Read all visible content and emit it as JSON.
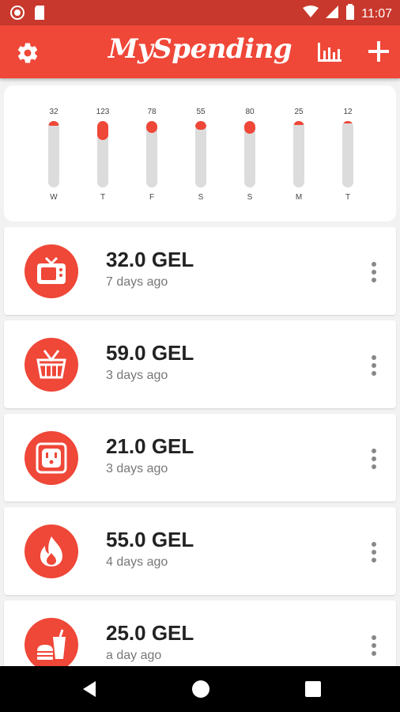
{
  "status_bar": {
    "time": "11:07"
  },
  "app_bar": {
    "title": "MySpending"
  },
  "chart_data": {
    "type": "bar",
    "categories": [
      "W",
      "T",
      "F",
      "S",
      "S",
      "M",
      "T"
    ],
    "values": [
      32,
      123,
      78,
      55,
      80,
      25,
      12
    ],
    "value_labels": [
      "32",
      "123",
      "78",
      "55",
      "80",
      "25",
      "12"
    ],
    "max": 123,
    "grid": false,
    "accent": "#ef4738",
    "track": "#dcdcdc"
  },
  "expenses": [
    {
      "amount": "32.0 GEL",
      "time": "7 days ago",
      "icon": "tv-icon"
    },
    {
      "amount": "59.0 GEL",
      "time": "3 days ago",
      "icon": "basket-icon"
    },
    {
      "amount": "21.0 GEL",
      "time": "3 days ago",
      "icon": "power-outlet-icon"
    },
    {
      "amount": "55.0 GEL",
      "time": "4 days ago",
      "icon": "flame-icon"
    },
    {
      "amount": "25.0 GEL",
      "time": "a day ago",
      "icon": "fast-food-icon"
    }
  ],
  "colors": {
    "primary": "#ef4738",
    "status_bar": "#c9382c",
    "background": "#f2f2f2"
  }
}
